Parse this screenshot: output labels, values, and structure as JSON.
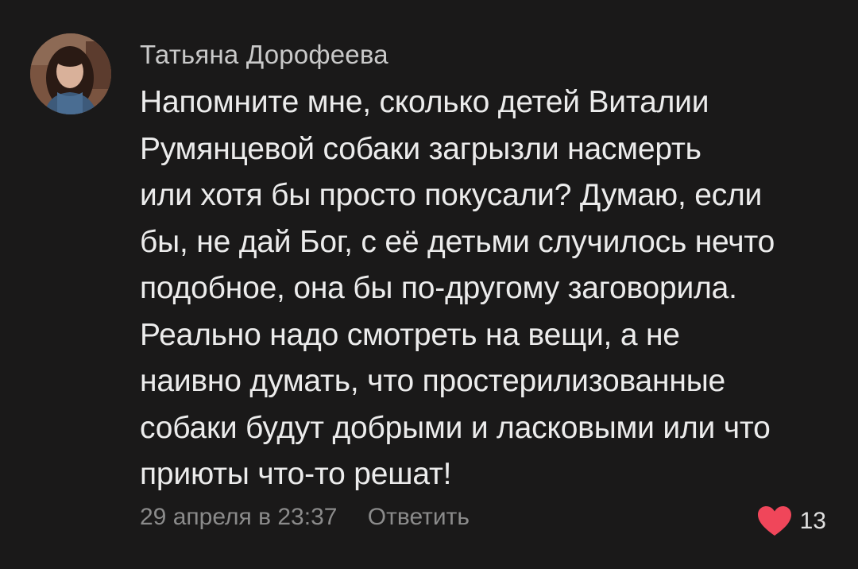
{
  "comment": {
    "author": "Татьяна Дорофеева",
    "lines": [
      "Напомните мне, сколько детей Виталии",
      "Румянцевой собаки загрызли насмерть",
      "или хотя бы просто покусали? Думаю, если",
      "бы, не дай Бог, с её детьми случилось нечто",
      "подобное, она бы по-другому заговорила.",
      "Реально надо смотреть на вещи, а не",
      "наивно думать, что простерилизованные",
      "собаки будут добрыми и ласковыми или что",
      "приюты что-то решат!"
    ],
    "date": "29 апреля в 23:37",
    "reply_label": "Ответить",
    "likes_count": "13",
    "heart_icon": "heart-icon",
    "heart_color": "#f0465a"
  }
}
